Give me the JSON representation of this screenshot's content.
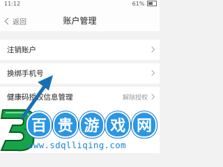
{
  "status_bar": {
    "time": "11:12",
    "battery": "61%"
  },
  "nav": {
    "back_label": "返回",
    "title": "账户管理"
  },
  "rows": [
    {
      "label": "注销账户",
      "value": ""
    },
    {
      "label": "换绑手机号",
      "value": ""
    },
    {
      "label": "健康码授权信息管理",
      "value": "解除授权"
    }
  ],
  "watermark": {
    "logo_text": "3",
    "title_chars": [
      "百",
      "贵",
      "游",
      "戏",
      "网"
    ],
    "url": "www.sdqlliqing.com"
  },
  "colors": {
    "accent": "#2a96e6",
    "arrow": "#1a6fb3"
  }
}
